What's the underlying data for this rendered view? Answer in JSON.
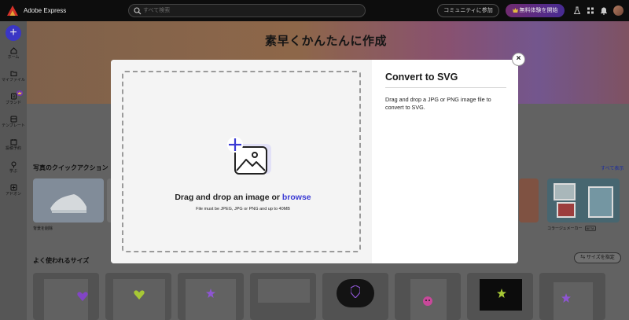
{
  "topbar": {
    "app_name": "Adobe Express",
    "search_placeholder": "すべて検索",
    "community_label": "コミュニティに参加",
    "trial_label": "無料体験を開始"
  },
  "sidebar": {
    "items": [
      {
        "label": "ホーム",
        "icon": "home-icon"
      },
      {
        "label": "マイファイル",
        "icon": "folder-icon"
      },
      {
        "label": "ブランド",
        "icon": "brand-icon"
      },
      {
        "label": "テンプレート",
        "icon": "template-icon"
      },
      {
        "label": "投稿予約",
        "icon": "calendar-icon"
      },
      {
        "label": "学ぶ",
        "icon": "learn-icon"
      },
      {
        "label": "アドオン",
        "icon": "addon-icon"
      }
    ]
  },
  "hero": {
    "title": "素早くかんたんに作成"
  },
  "quick_actions": {
    "title": "写真のクイックアクション",
    "see_all": "すべて表示",
    "cards": [
      {
        "label": "背景を削除"
      },
      {
        "label": "コラージュメーカー",
        "badge": "BETA"
      }
    ]
  },
  "popular_sizes": {
    "title": "よく使われるサイズ",
    "button": "サイズを指定"
  },
  "modal": {
    "title": "Convert to SVG",
    "description": "Drag and drop a JPG or PNG image file to convert to SVG.",
    "drop_text": "Drag and drop an image or ",
    "browse_link": "browse",
    "file_note": "File must be JPEG, JPG or PNG and up to 40MB",
    "close_symbol": "×"
  },
  "colors": {
    "accent": "#3b3bd4",
    "create_button": "#3f3bd6",
    "trial_gradient_start": "#7b2f7a",
    "trial_gradient_end": "#4e2fa0"
  }
}
